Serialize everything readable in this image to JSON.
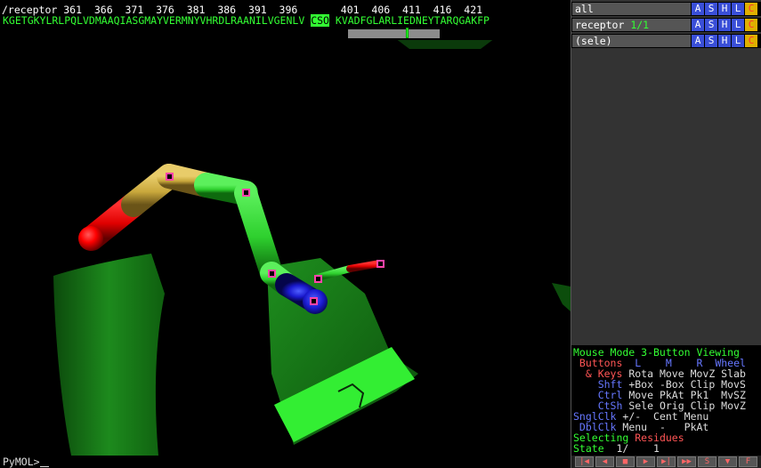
{
  "sequence": {
    "numbers_line": "/receptor 361  366  371  376  381  386  391  396       401  406  411  416  421",
    "residues_before": "KGETGKYLRLPQLVDMAAQIASGMAYVERMNYVHRDLRAANILVGENLV ",
    "residue_selected": "CSO",
    "residues_after": " KVADFGLARLIEDNEYTARQGAKFP"
  },
  "objects": [
    {
      "name": "all",
      "state": ""
    },
    {
      "name": "receptor",
      "state": "1/1"
    },
    {
      "name": "(sele)",
      "state": ""
    }
  ],
  "object_buttons": [
    "A",
    "S",
    "H",
    "L",
    "C"
  ],
  "mouse_panel": {
    "mode_line": "Mouse Mode 3-Button Viewing",
    "buttons_label": " Buttons",
    "col_L": "L",
    "col_M": "M",
    "col_R": "R",
    "col_wheel": "Wheel",
    "rows": [
      {
        "key": "  & Keys",
        "vals": "Rota Move MovZ Slab"
      },
      {
        "key": "    Shft",
        "vals": "+Box -Box Clip MovS"
      },
      {
        "key": "    Ctrl",
        "vals": "Move PkAt Pk1  MvSZ"
      },
      {
        "key": "    CtSh",
        "vals": "Sele Orig Clip MovZ"
      },
      {
        "key": "SnglClk",
        "vals": "+/-  Cent Menu"
      },
      {
        "key": " DblClk",
        "vals": "Menu  -   PkAt"
      }
    ],
    "selecting_label": "Selecting",
    "selecting_value": "Residues",
    "state_label": "State",
    "state_value": "  1/    1"
  },
  "command_prompt": "PyMOL>",
  "controls": [
    "|◀",
    "◀",
    "■",
    "▶",
    "▶|",
    "▶▶",
    "S",
    "▼",
    "F"
  ],
  "colors": {
    "background": "#000000",
    "panel": "#333333",
    "cartoon": "#1f9e1f",
    "carbon": "#2ecc2e",
    "oxygen": "#ff0000",
    "nitrogen": "#2222cc",
    "sulfur": "#d4b040",
    "selection_marker": "#ff44aa"
  }
}
